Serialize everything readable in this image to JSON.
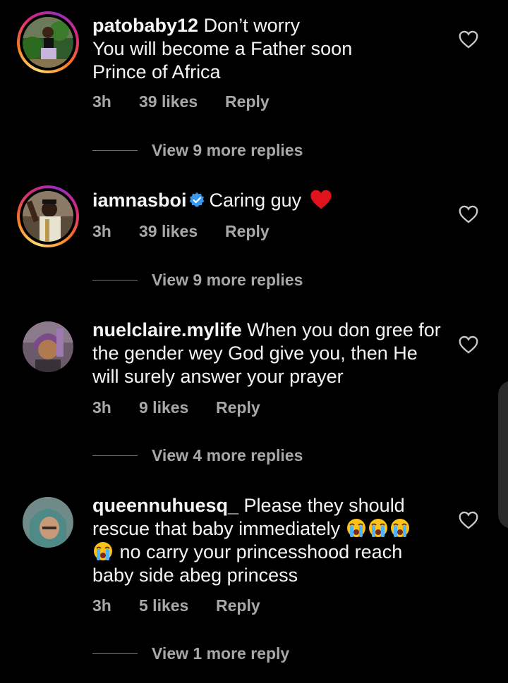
{
  "comments": [
    {
      "username": "patobaby12",
      "text_lines": [
        "Don’t worry",
        "You will become a Father soon",
        "Prince of Africa"
      ],
      "time": "3h",
      "likes": "39 likes",
      "reply": "Reply",
      "view_replies": "View 9 more replies",
      "avatar_icon": "avatar-photo-woman-green",
      "has_story_ring": true
    },
    {
      "username": "iamnasboi",
      "verified": true,
      "text": "Caring guy",
      "emoji": "red-heart",
      "time": "3h",
      "likes": "39 likes",
      "reply": "Reply",
      "view_replies": "View 9 more replies",
      "avatar_icon": "avatar-photo-man-waving",
      "has_story_ring": true
    },
    {
      "username": "nuelclaire.mylife",
      "text_lines": [
        "When you don gree for",
        "the gender wey God give you, then He",
        "will surely answer your prayer"
      ],
      "time": "3h",
      "likes": "9 likes",
      "reply": "Reply",
      "view_replies": "View 4 more replies",
      "avatar_icon": "avatar-photo-woman-headwrap",
      "has_story_ring": false
    },
    {
      "username": "queennuhuesq_",
      "text_lines": [
        "Please they should",
        "rescue that baby immediately",
        "no carry your princesshood reach",
        "baby side abeg princess"
      ],
      "emoji": "loudly-crying-face",
      "time": "3h",
      "likes": "5 likes",
      "reply": "Reply",
      "view_replies": "View 1 more reply",
      "avatar_icon": "avatar-photo-woman-hijab",
      "has_story_ring": false
    }
  ],
  "colors": {
    "background": "#000000",
    "text": "#f5f5f5",
    "muted": "#a8a8a8",
    "verified_blue": "#3897f0",
    "heart_red": "#e0121b"
  }
}
